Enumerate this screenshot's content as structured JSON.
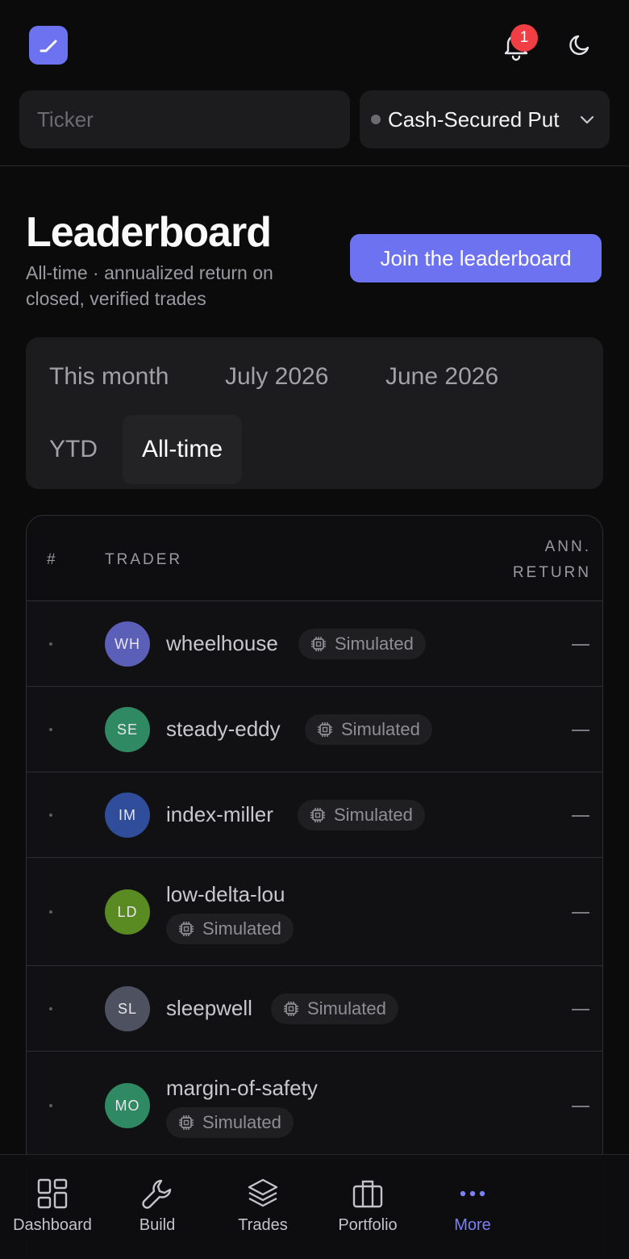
{
  "header": {
    "notification_count": "1",
    "ticker_placeholder": "Ticker",
    "strategy_label": "Cash-Secured Put"
  },
  "page": {
    "title": "Leaderboard",
    "subtitle": "All-time · annualized return on closed, verified trades",
    "join_label": "Join the leaderboard"
  },
  "tabs": [
    {
      "label": "This month",
      "active": false
    },
    {
      "label": "July 2026",
      "active": false
    },
    {
      "label": "June 2026",
      "active": false
    },
    {
      "label": "YTD",
      "active": false
    },
    {
      "label": "All-time",
      "active": true
    }
  ],
  "table": {
    "col_rank": "#",
    "col_trader": "TRADER",
    "col_return_line1": "ANN.",
    "col_return_line2": "RETURN",
    "rows": [
      {
        "initials": "WH",
        "name": "wheelhouse",
        "tag": "Simulated",
        "return": "—",
        "avatar_color": "#5b5fb8"
      },
      {
        "initials": "SE",
        "name": "steady-eddy",
        "tag": "Simulated",
        "return": "—",
        "avatar_color": "#2f8a63"
      },
      {
        "initials": "IM",
        "name": "index-miller",
        "tag": "Simulated",
        "return": "—",
        "avatar_color": "#2f4d9a"
      },
      {
        "initials": "LD",
        "name": "low-delta-lou",
        "tag": "Simulated",
        "return": "—",
        "avatar_color": "#5a8a22"
      },
      {
        "initials": "SL",
        "name": "sleepwell",
        "tag": "Simulated",
        "return": "—",
        "avatar_color": "#4e5260"
      },
      {
        "initials": "MO",
        "name": "margin-of-safety",
        "tag": "Simulated",
        "return": "—",
        "avatar_color": "#2f8a63"
      }
    ]
  },
  "nav": [
    {
      "label": "Dashboard",
      "icon": "grid-icon",
      "active": false
    },
    {
      "label": "Build",
      "icon": "wrench-icon",
      "active": false
    },
    {
      "label": "Trades",
      "icon": "layers-icon",
      "active": false
    },
    {
      "label": "Portfolio",
      "icon": "briefcase-icon",
      "active": false
    },
    {
      "label": "More",
      "icon": "more-dots-icon",
      "active": true
    }
  ],
  "colors": {
    "accent": "#6d72f0",
    "badge": "#ef3f44",
    "background": "#0b0b0c"
  }
}
